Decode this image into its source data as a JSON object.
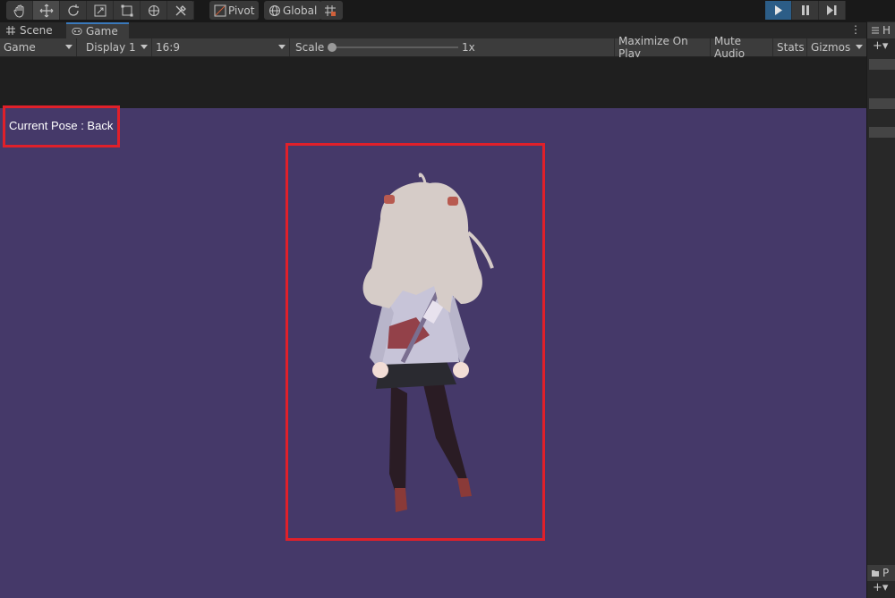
{
  "toolbar": {
    "pivot_label": "Pivot",
    "global_label": "Global"
  },
  "tabs": [
    {
      "label": "Scene",
      "active": false
    },
    {
      "label": "Game",
      "active": true
    }
  ],
  "game_bar": {
    "mode_value": "Game",
    "display_value": "Display 1",
    "aspect_value": "16:9",
    "scale_label": "Scale",
    "scale_value": "1x",
    "maximize_label": "Maximize On Play",
    "mute_label": "Mute Audio",
    "stats_label": "Stats",
    "gizmos_label": "Gizmos"
  },
  "viewport": {
    "pose_text": "Current Pose : Back",
    "background": "#453969"
  },
  "right_panel": {
    "tab_label": "H",
    "bottom_tab_label": "P"
  },
  "colors": {
    "highlight": "#e0202a",
    "play_active": "#2c5d87",
    "tab_accent": "#3a79bb"
  }
}
